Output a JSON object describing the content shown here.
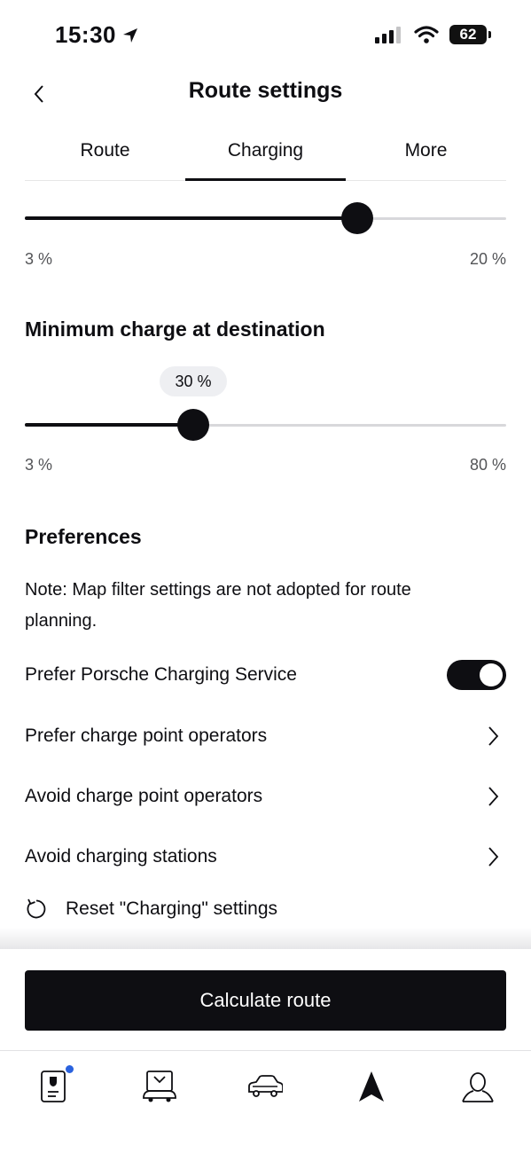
{
  "status_bar": {
    "time": "15:30",
    "battery": "62"
  },
  "header": {
    "title": "Route settings"
  },
  "tabs": [
    {
      "label": "Route",
      "active": false
    },
    {
      "label": "Charging",
      "active": true
    },
    {
      "label": "More",
      "active": false
    }
  ],
  "slider_top": {
    "value_fraction": 0.69,
    "min_label": "3 %",
    "max_label": "20 %"
  },
  "slider_destination": {
    "heading": "Minimum charge at destination",
    "value_label": "30 %",
    "value_fraction": 0.35,
    "min_label": "3 %",
    "max_label": "80 %"
  },
  "preferences": {
    "heading": "Preferences",
    "note": "Note: Map filter settings are not adopted for route planning.",
    "toggle_row": {
      "label": "Prefer Porsche Charging Service",
      "on": true
    },
    "rows": [
      {
        "label": "Prefer charge point operators"
      },
      {
        "label": "Avoid charge point operators"
      },
      {
        "label": "Avoid charging stations"
      }
    ],
    "reset_label": "Reset \"Charging\" settings"
  },
  "primary_button": {
    "label": "Calculate route"
  },
  "tabbar": {
    "items": [
      {
        "icon": "phone-key-icon",
        "badge": true
      },
      {
        "icon": "charging-car-icon",
        "badge": false
      },
      {
        "icon": "car-icon",
        "badge": false
      },
      {
        "icon": "navigation-arrow-icon",
        "badge": false,
        "active": true
      },
      {
        "icon": "profile-icon",
        "badge": false
      }
    ]
  },
  "colors": {
    "text": "#0e0e12",
    "muted": "#535457",
    "track": "#d8d8db",
    "bubble": "#eeeff2",
    "badge": "#2a62de"
  }
}
